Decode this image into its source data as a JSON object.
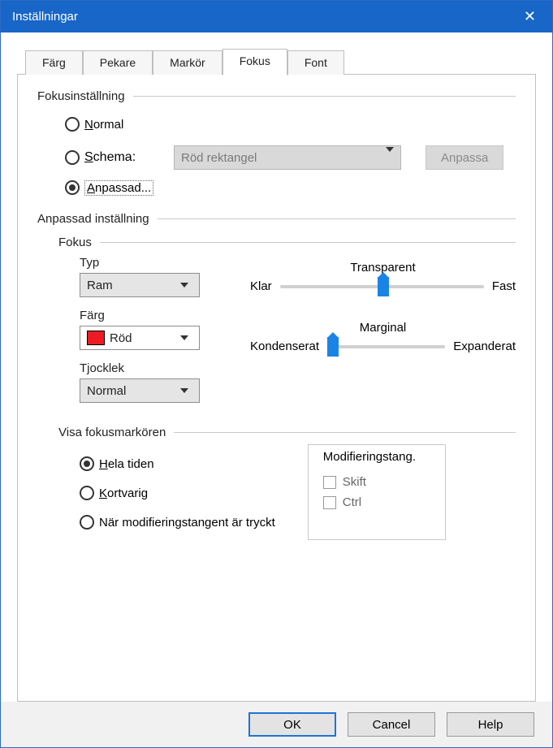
{
  "title": "Inställningar",
  "tabs": [
    "Färg",
    "Pekare",
    "Markör",
    "Fokus",
    "Font"
  ],
  "active_tab": "Fokus",
  "fokus_setting": {
    "group": "Fokusinställning",
    "normal": "Normal",
    "schema": "Schema:",
    "schema_value": "Röd rektangel",
    "anpassa_btn": "Anpassa",
    "anpassad": "Anpassad..."
  },
  "custom": {
    "group": "Anpassad inställning",
    "fokus_group": "Fokus",
    "type_label": "Typ",
    "type_value": "Ram",
    "color_label": "Färg",
    "color_value": "Röd",
    "thick_label": "Tjocklek",
    "thick_value": "Normal",
    "slider1": {
      "title": "Transparent",
      "left": "Klar",
      "right": "Fast"
    },
    "slider2": {
      "title": "Marginal",
      "left": "Kondenserat",
      "right": "Expanderat"
    }
  },
  "display_marker": {
    "group": "Visa fokusmarkören",
    "opt1": "Hela tiden",
    "opt2": "Kortvarig",
    "opt3": "När modifieringstangent är tryckt",
    "mod_group": "Modifieringstang.",
    "shift": "Skift",
    "ctrl": "Ctrl"
  },
  "buttons": {
    "ok": "OK",
    "cancel": "Cancel",
    "help": "Help"
  }
}
